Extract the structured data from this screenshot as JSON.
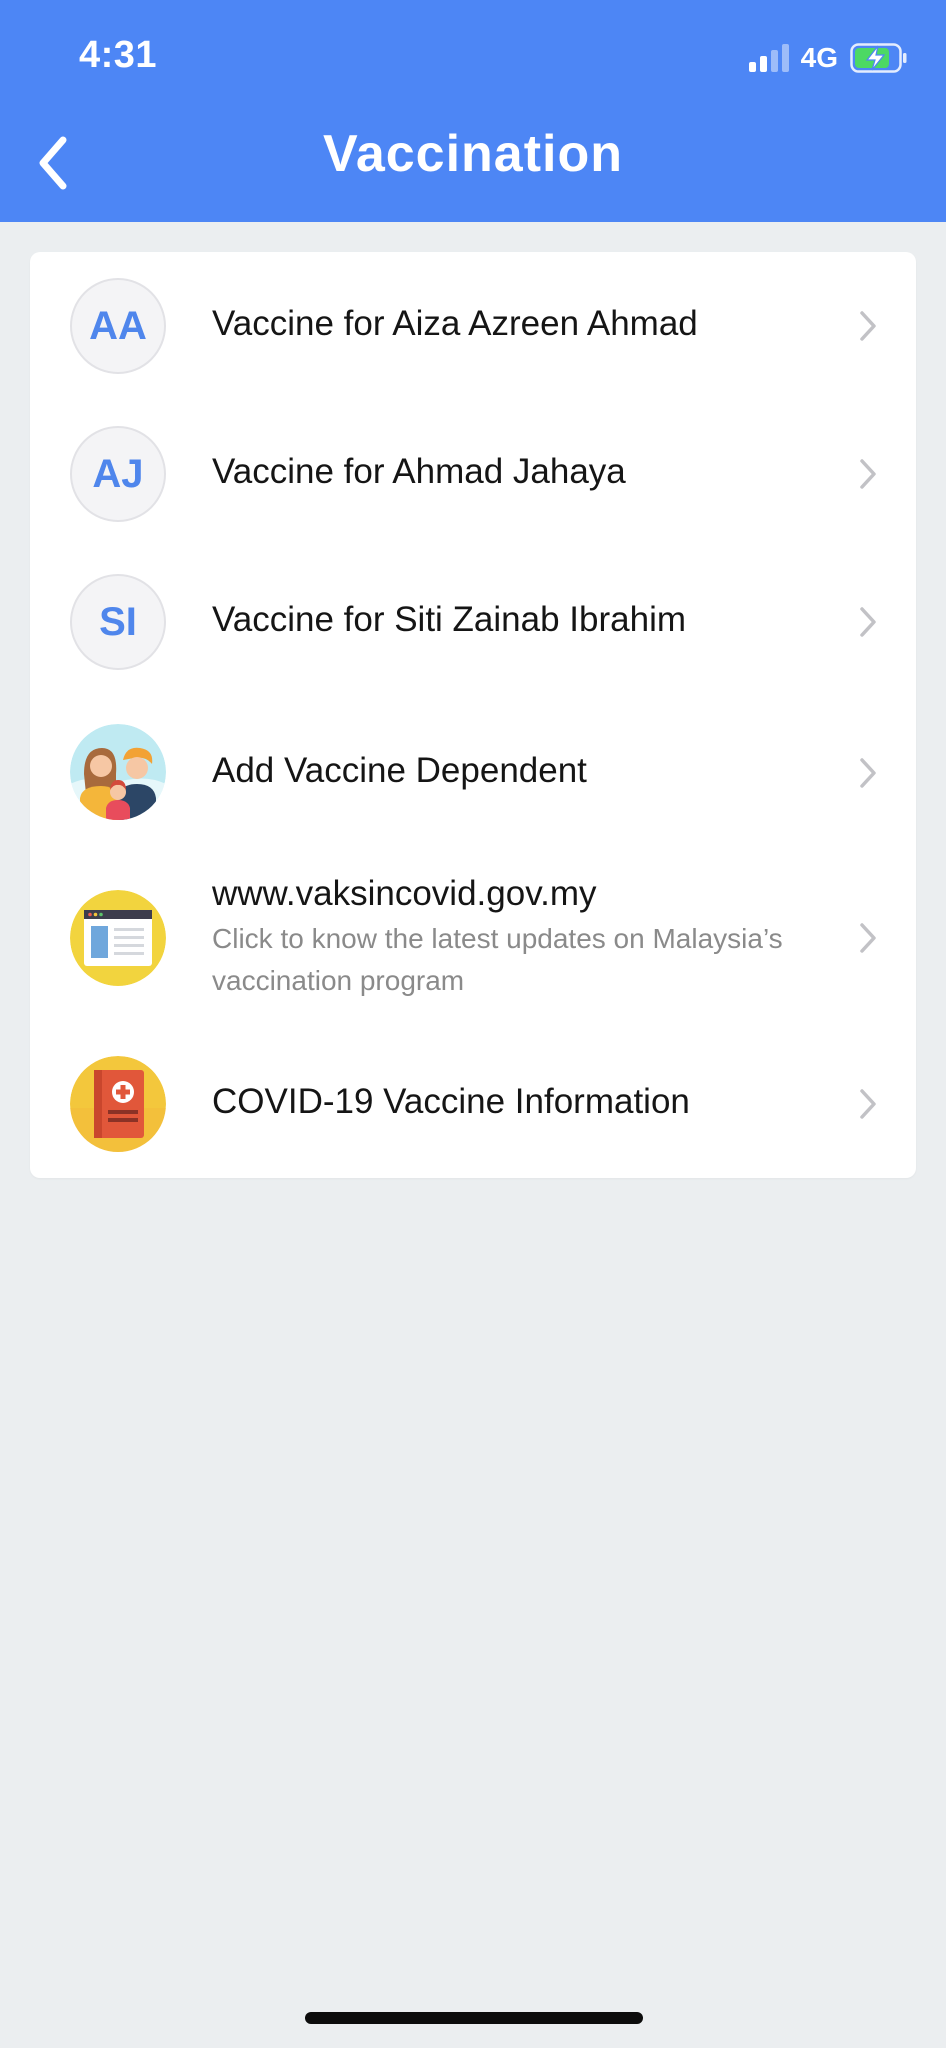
{
  "status_bar": {
    "time": "4:31",
    "network": "4G",
    "signal_bars_filled": 2,
    "signal_bars_total": 4,
    "battery_charging": true
  },
  "header": {
    "title": "Vaccination",
    "back_icon": "chevron-left-icon"
  },
  "colors": {
    "header_bg": "#4d86f5",
    "page_bg": "#ebeef0",
    "initials_text": "#4f86ec",
    "card_bg": "#ffffff"
  },
  "menu": {
    "items": [
      {
        "avatar": "AA",
        "label": "Vaccine for Aiza Azreen Ahmad",
        "icon": "chevron-right-icon"
      },
      {
        "avatar": "AJ",
        "label": "Vaccine for Ahmad Jahaya",
        "icon": "chevron-right-icon"
      },
      {
        "avatar": "SI",
        "label": "Vaccine for Siti Zainab Ibrahim",
        "icon": "chevron-right-icon"
      },
      {
        "avatar_icon": "family-icon",
        "label": "Add Vaccine Dependent",
        "icon": "chevron-right-icon"
      },
      {
        "avatar_icon": "website-icon",
        "label": "www.vaksincovid.gov.my",
        "subtitle": "Click to know the latest updates on Malaysia’s vaccination program",
        "icon": "chevron-right-icon"
      },
      {
        "avatar_icon": "medical-book-icon",
        "label": "COVID-19 Vaccine Information",
        "icon": "chevron-right-icon"
      }
    ]
  }
}
